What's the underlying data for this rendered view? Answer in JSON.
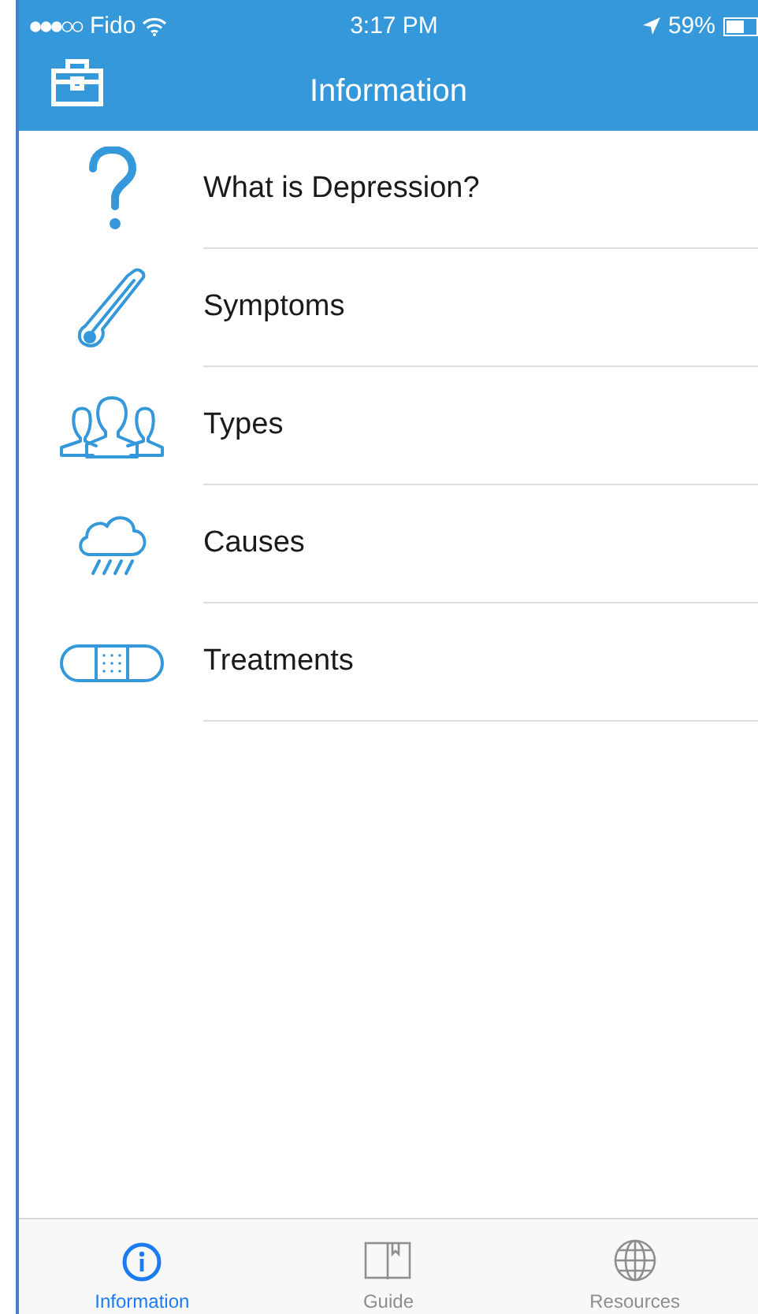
{
  "status_bar": {
    "carrier": "Fido",
    "time": "3:17 PM",
    "battery": "59%"
  },
  "header": {
    "title": "Information"
  },
  "items": [
    {
      "kind": "question",
      "label": "What is Depression?"
    },
    {
      "kind": "thermometer",
      "label": "Symptoms"
    },
    {
      "kind": "people",
      "label": "Types"
    },
    {
      "kind": "cloud",
      "label": "Causes"
    },
    {
      "kind": "bandage",
      "label": "Treatments"
    }
  ],
  "tabs": [
    {
      "kind": "info",
      "label": "Information",
      "selected": true
    },
    {
      "kind": "book",
      "label": "Guide",
      "selected": false
    },
    {
      "kind": "globe",
      "label": "Resources",
      "selected": false
    }
  ]
}
